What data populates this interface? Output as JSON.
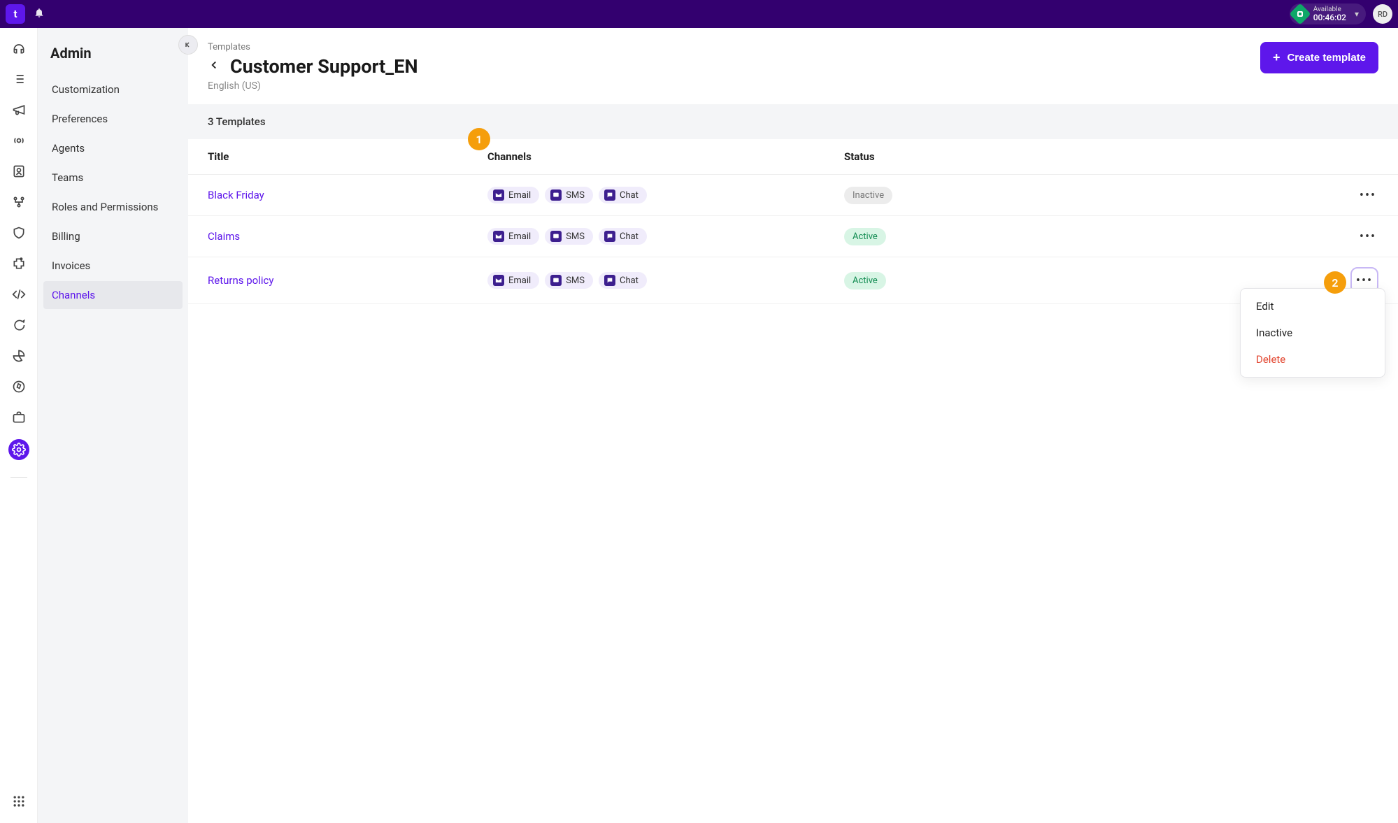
{
  "topbar": {
    "logo_letter": "t",
    "status_label": "Available",
    "status_time": "00:46:02",
    "avatar_initials": "RD"
  },
  "sidebar": {
    "title": "Admin",
    "items": [
      {
        "label": "Customization",
        "active": false
      },
      {
        "label": "Preferences",
        "active": false
      },
      {
        "label": "Agents",
        "active": false
      },
      {
        "label": "Teams",
        "active": false
      },
      {
        "label": "Roles and Permissions",
        "active": false
      },
      {
        "label": "Billing",
        "active": false
      },
      {
        "label": "Invoices",
        "active": false
      },
      {
        "label": "Channels",
        "active": true
      }
    ]
  },
  "header": {
    "breadcrumb": "Templates",
    "title": "Customer Support_EN",
    "subtitle": "English (US)",
    "create_button": "Create template"
  },
  "table": {
    "count_label": "3 Templates",
    "columns": {
      "title": "Title",
      "channels": "Channels",
      "status": "Status"
    },
    "channel_labels": {
      "email": "Email",
      "sms": "SMS",
      "chat": "Chat"
    },
    "rows": [
      {
        "title": "Black Friday",
        "status": "Inactive"
      },
      {
        "title": "Claims",
        "status": "Active"
      },
      {
        "title": "Returns policy",
        "status": "Active"
      }
    ]
  },
  "dropdown": {
    "edit": "Edit",
    "inactive": "Inactive",
    "delete": "Delete"
  },
  "callouts": {
    "one": "1",
    "two": "2"
  }
}
